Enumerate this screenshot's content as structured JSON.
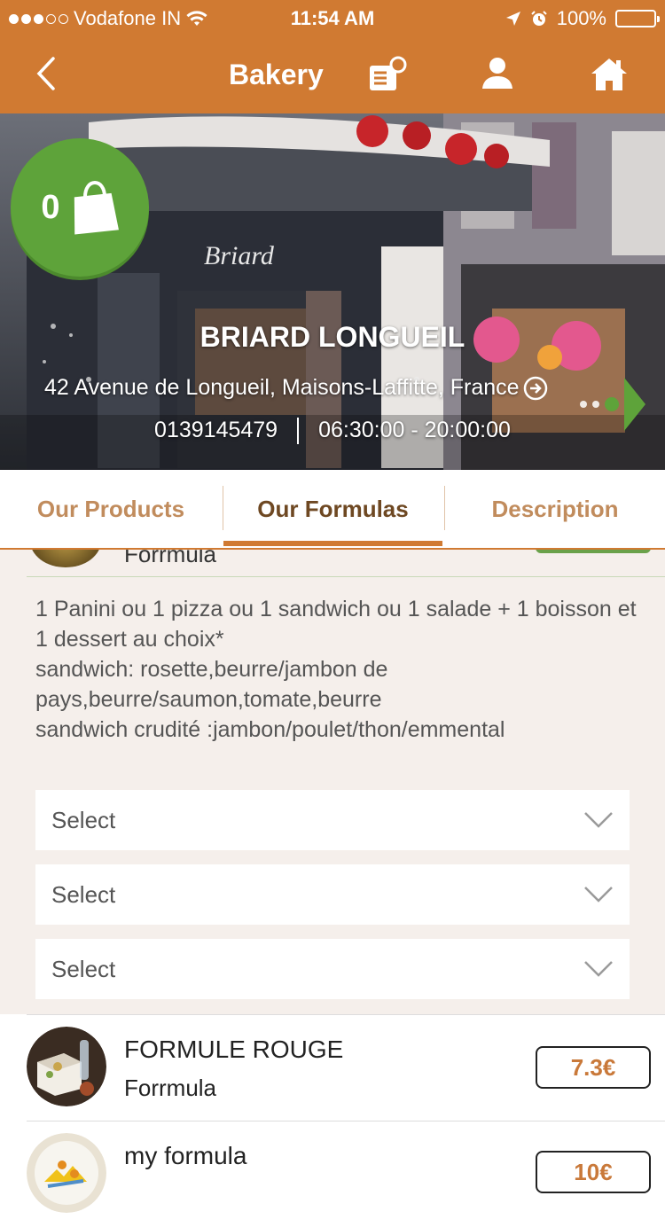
{
  "status_bar": {
    "carrier": "Vodafone IN",
    "time": "11:54 AM",
    "battery": "100%",
    "battery_level": 1.0
  },
  "nav": {
    "title": "Bakery",
    "back_icon": "chevron-left-icon",
    "icons": [
      "menu-search-icon",
      "user-icon",
      "home-icon"
    ]
  },
  "shop": {
    "name": "BRIARD LONGUEIL",
    "address": "42 Avenue de Longueil, Maisons-Laffitte, France",
    "phone": "0139145479",
    "hours": "06:30:00 - 20:00:00",
    "cart_count": "0"
  },
  "tabs": [
    "Our Products",
    "Our Formulas",
    "Description"
  ],
  "active_tab": "Our Formulas",
  "formula_panel": {
    "subtitle": "Forrmula",
    "description": "1 Panini ou 1 pizza ou 1 sandwich ou 1 salade + 1 boisson et 1 dessert au choix*\nsandwich: rosette,beurre/jambon de pays,beurre/saumon,tomate,beurre\nsandwich crudité :jambon/poulet/thon/emmental",
    "selects": [
      {
        "value": "Select"
      },
      {
        "value": "Select"
      },
      {
        "value": "Select"
      }
    ]
  },
  "formulas": [
    {
      "title": "FORMULE ROUGE",
      "subtitle": "Forrmula",
      "price": "7.3€"
    },
    {
      "title": "my formula",
      "subtitle": "",
      "price": "10€"
    }
  ],
  "colors": {
    "accent": "#d07a32",
    "green": "#5ea33a",
    "tab_text": "#c18c5d",
    "tab_active": "#6e4822"
  }
}
